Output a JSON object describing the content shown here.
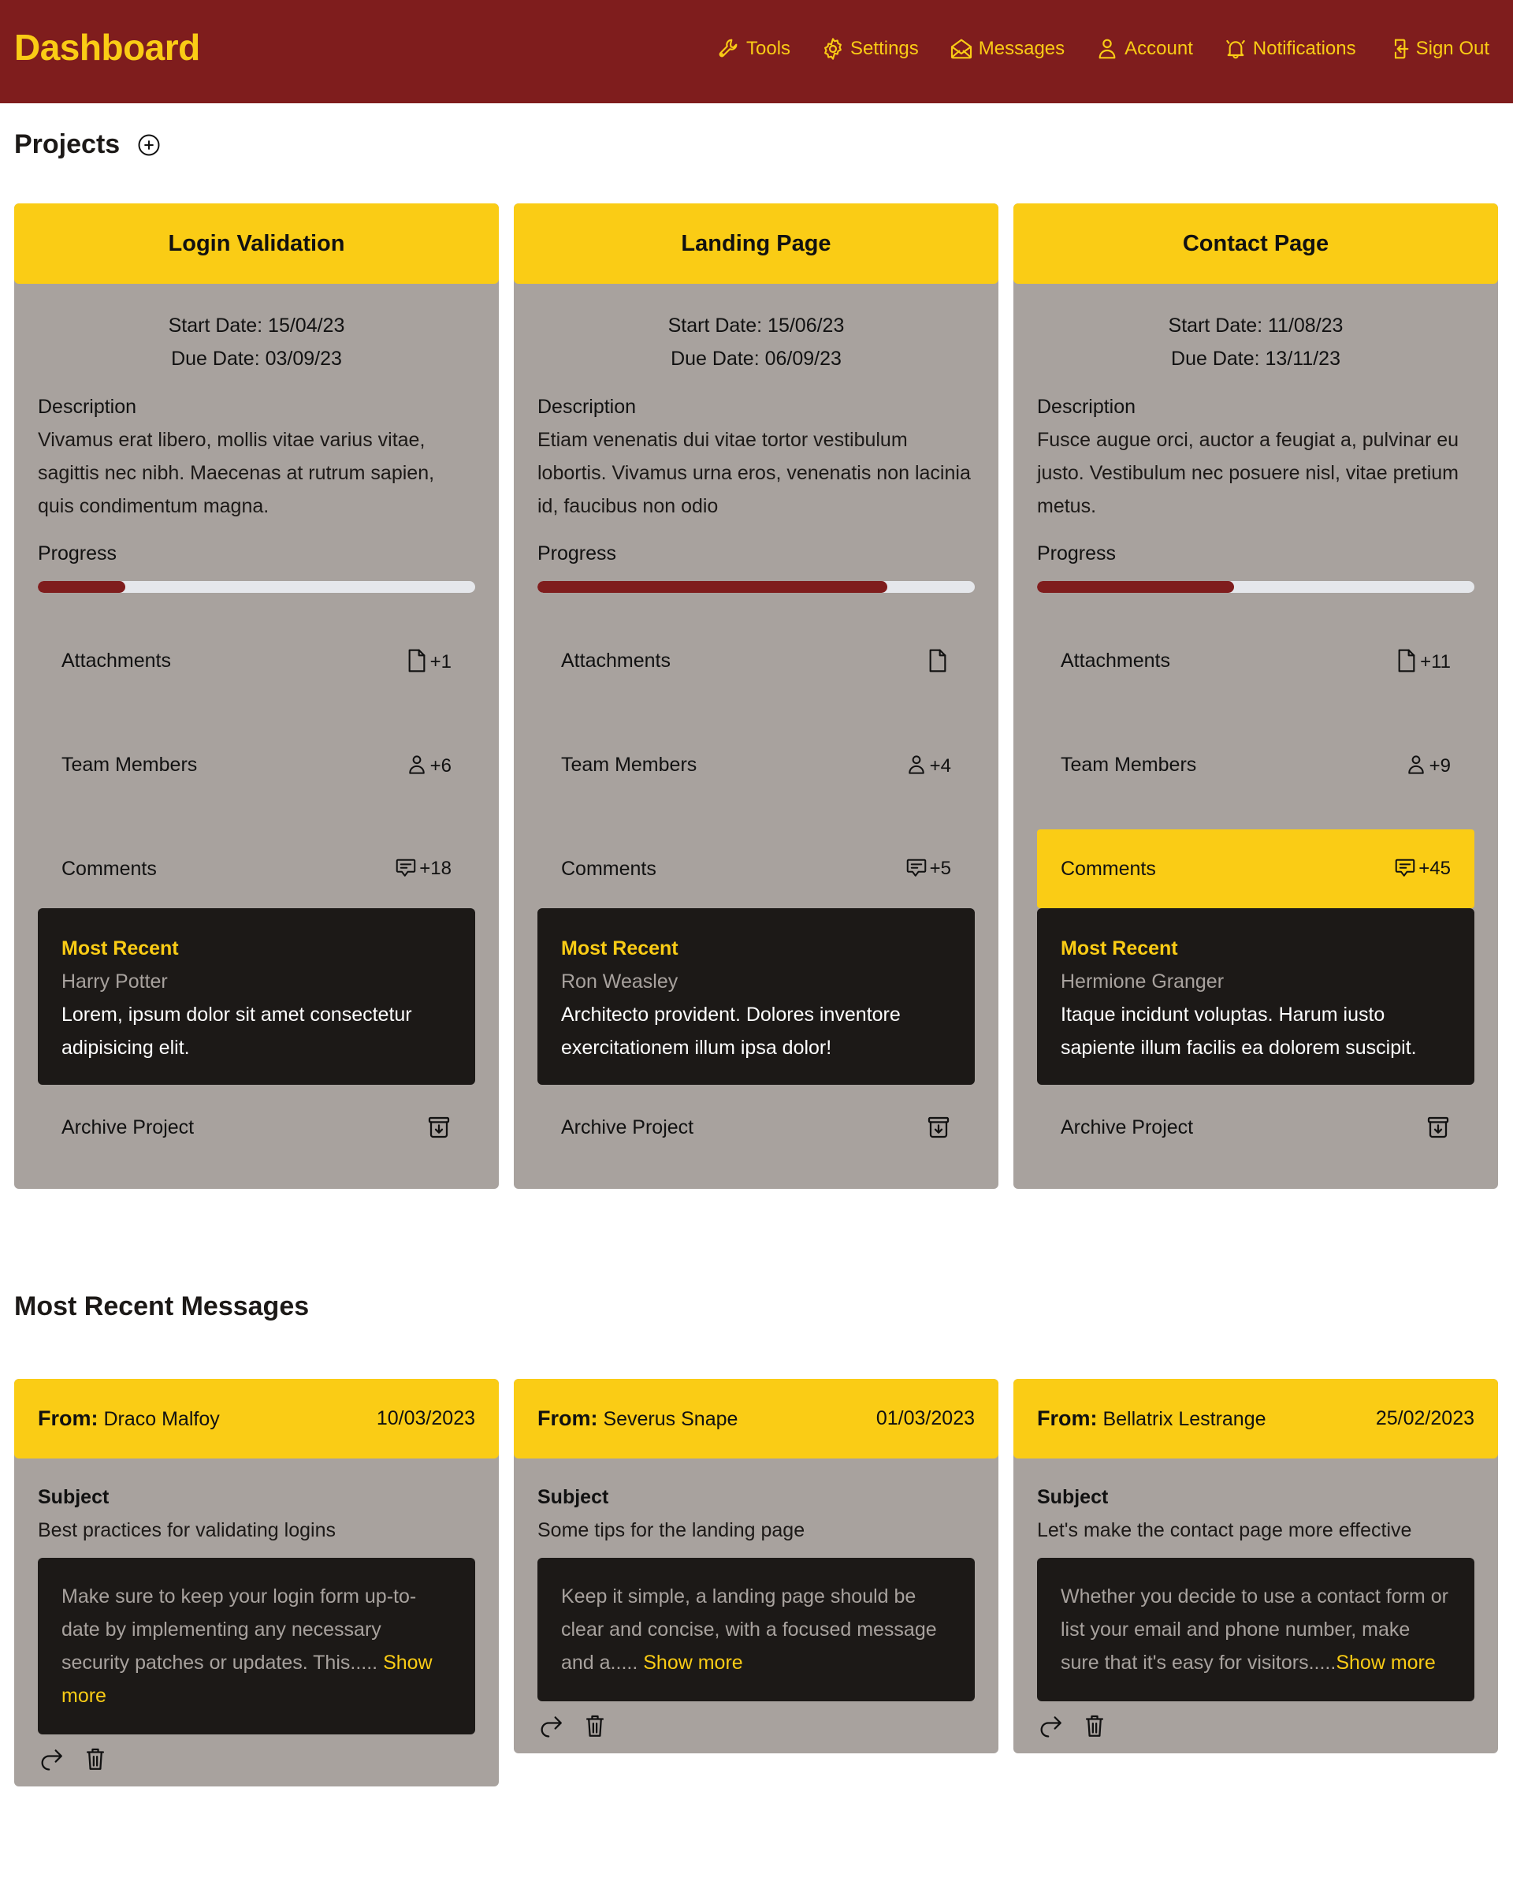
{
  "header": {
    "title": "Dashboard",
    "nav": [
      {
        "label": "Tools",
        "icon": "wrench-icon"
      },
      {
        "label": "Settings",
        "icon": "gear-icon"
      },
      {
        "label": "Messages",
        "icon": "envelope-open-icon"
      },
      {
        "label": "Account",
        "icon": "user-icon"
      },
      {
        "label": "Notifications",
        "icon": "bell-icon"
      },
      {
        "label": "Sign Out",
        "icon": "sign-out-icon"
      }
    ]
  },
  "projects": {
    "title": "Projects",
    "add_icon": "plus-circle-icon",
    "labels": {
      "description": "Description",
      "progress": "Progress",
      "attachments": "Attachments",
      "team_members": "Team Members",
      "comments": "Comments",
      "most_recent": "Most Recent",
      "archive": "Archive Project"
    },
    "items": [
      {
        "name": "Login Validation",
        "start_date": "Start Date: 15/04/23",
        "due_date": "Due Date: 03/09/23",
        "description": "Vivamus erat libero, mollis vitae varius vitae, sagittis nec nibh. Maecenas at rutrum sapien, quis condimentum magna.",
        "progress": 0.2,
        "attachments": "+1",
        "team_members": "+6",
        "comments": "+18",
        "comments_highlighted": false,
        "recent_author": "Harry Potter",
        "recent_text": "Lorem, ipsum dolor sit amet consectetur adipisicing elit."
      },
      {
        "name": "Landing Page",
        "start_date": "Start Date: 15/06/23",
        "due_date": "Due Date: 06/09/23",
        "description": "Etiam venenatis dui vitae tortor vestibulum lobortis. Vivamus urna eros, venenatis non lacinia id, faucibus non odio",
        "progress": 0.8,
        "attachments": "",
        "team_members": "+4",
        "comments": "+5",
        "comments_highlighted": false,
        "recent_author": "Ron Weasley",
        "recent_text": "Architecto provident. Dolores inventore exercitationem illum ipsa dolor!"
      },
      {
        "name": "Contact Page",
        "start_date": "Start Date: 11/08/23",
        "due_date": "Due Date: 13/11/23",
        "description": "Fusce augue orci, auctor a feugiat a, pulvinar eu justo. Vestibulum nec posuere nisl, vitae pretium metus.",
        "progress": 0.45,
        "attachments": "+11",
        "team_members": "+9",
        "comments": "+45",
        "comments_highlighted": true,
        "recent_author": "Hermione Granger",
        "recent_text": "Itaque incidunt voluptas. Harum iusto sapiente illum facilis ea dolorem suscipit."
      }
    ]
  },
  "messages": {
    "title": "Most Recent Messages",
    "labels": {
      "from": "From:",
      "subject": "Subject"
    },
    "items": [
      {
        "from": "Draco Malfoy",
        "date": "10/03/2023",
        "subject": "Best practices for validating logins",
        "preview": "Make sure to keep your login form up-to-date by implementing any necessary security patches or updates. This..... ",
        "show_more": "Show more"
      },
      {
        "from": "Severus Snape",
        "date": "01/03/2023",
        "subject": "Some tips for the landing page",
        "preview": "Keep it simple, a landing page should be clear and concise, with a focused message and a..... ",
        "show_more": "Show more"
      },
      {
        "from": "Bellatrix Lestrange",
        "date": "25/02/2023",
        "subject": "Let's make the contact page more effective",
        "preview": "Whether you decide to use a contact form or list your email and phone number, make sure that it's easy for visitors.....",
        "show_more": "Show more"
      }
    ]
  },
  "colors": {
    "header_bg": "#7f1d1d",
    "accent": "#facc15",
    "card_bg": "#a8a29e",
    "dark_box": "#1c1917",
    "progress_fill": "#7f1d1d",
    "progress_track": "#e5e7eb"
  }
}
